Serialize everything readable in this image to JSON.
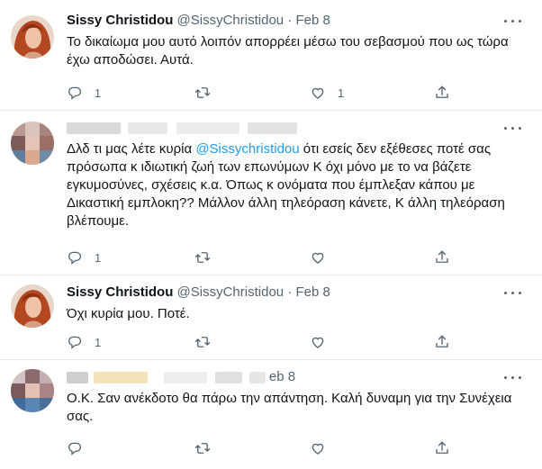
{
  "tweets": [
    {
      "name": "Sissy Christidou",
      "handle": "@SissyChristidou",
      "sep": "·",
      "date": "Feb 8",
      "text": "Το δικαίωμα μου αυτό λοιπόν απορρέει μέσω του σεβασμού που ως τώρα έχω αποδώσει. Αυτά.",
      "replies": "1",
      "retweets": "",
      "likes": "1"
    },
    {
      "name": "",
      "handle": "",
      "sep": "",
      "date": "",
      "text_before": "Δλδ τι μας λέτε κυρία ",
      "mention": "@Sissychristidou",
      "text_after": " ότι εσείς δεν εξέθεσες ποτέ σας πρόσωπα κ ιδιωτική ζωή των επωνύμων Κ όχι μόνο με το να βάζετε εγκυμοσύνες, σχέσεις κ.α. Όπως κ ονόματα που έμπλεξαν κάπου με Δικαστική εμπλοκη?? Μάλλον άλλη τηλεόραση κάνετε, Κ άλλη τηλεόραση βλέπουμε.",
      "replies": "1",
      "retweets": "",
      "likes": ""
    },
    {
      "name": "Sissy Christidou",
      "handle": "@SissyChristidou",
      "sep": "·",
      "date": "Feb 8",
      "text": "Όχι κυρία μου. Ποτέ.",
      "replies": "1",
      "retweets": "",
      "likes": ""
    },
    {
      "name": "",
      "handle": "",
      "sep": "",
      "date": "eb 8",
      "text": "Ο.Κ. Σαν ανέκδοτο θα πάρω την απάντηση. Καλή δυναμη για την Συνέχεια σας.",
      "replies": "",
      "retweets": "",
      "likes": ""
    }
  ],
  "icons": [
    "reply-icon",
    "retweet-icon",
    "like-icon",
    "share-icon",
    "more-icon"
  ],
  "colors": {
    "text": "#0f1419",
    "secondary": "#536471",
    "link": "#1d9bf0",
    "divider": "#e6ecf0"
  }
}
